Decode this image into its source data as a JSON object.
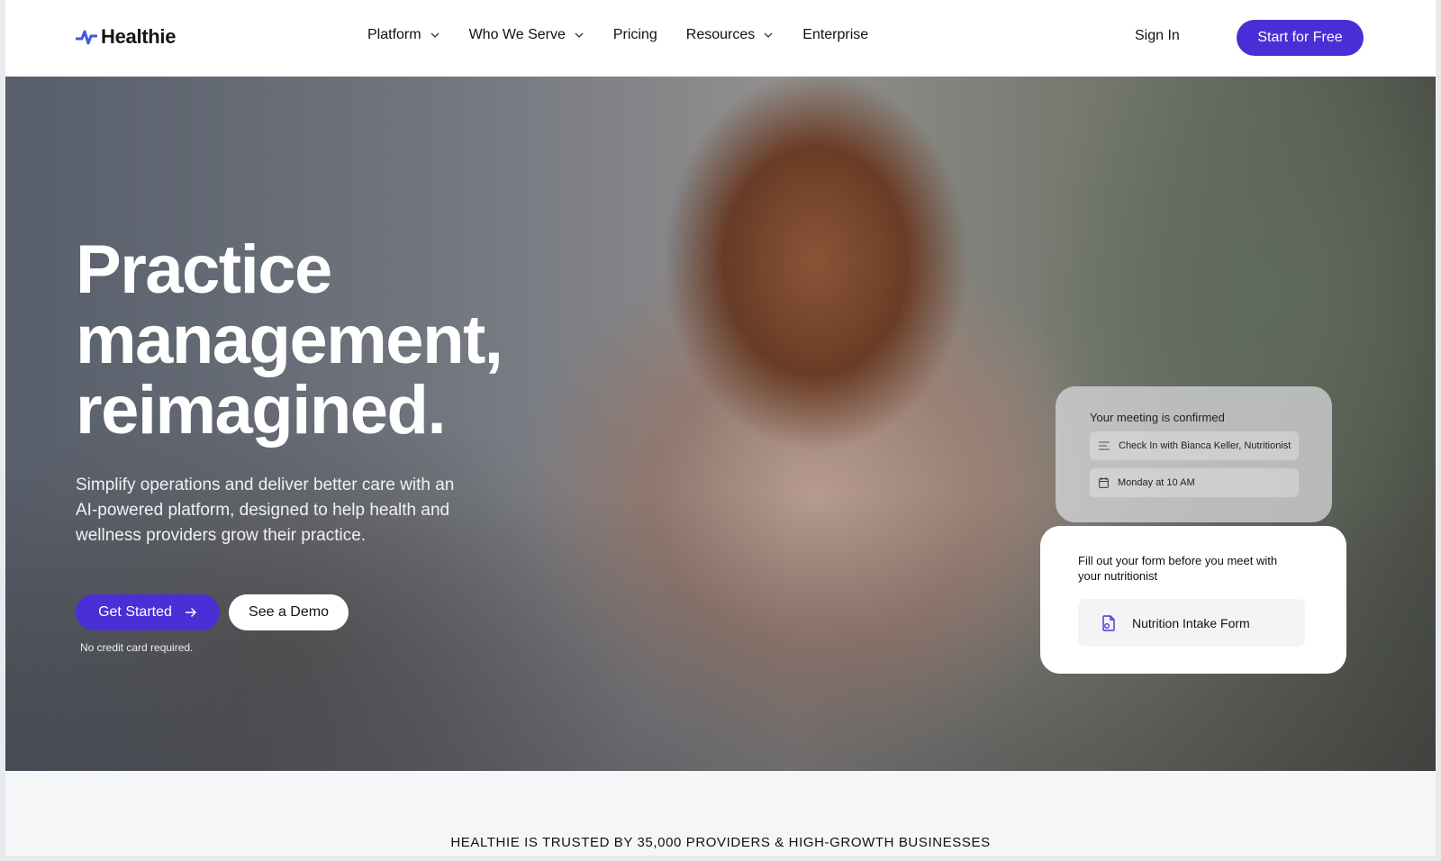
{
  "header": {
    "logo_text": "Healthie",
    "nav": [
      {
        "label": "Platform",
        "has_dropdown": true
      },
      {
        "label": "Who We Serve",
        "has_dropdown": true
      },
      {
        "label": "Pricing",
        "has_dropdown": false
      },
      {
        "label": "Resources",
        "has_dropdown": true
      },
      {
        "label": "Enterprise",
        "has_dropdown": false
      }
    ],
    "sign_in": "Sign In",
    "cta": "Start for Free"
  },
  "hero": {
    "title_lines": [
      "Practice",
      "management,",
      "reimagined."
    ],
    "subtitle": "Simplify operations and deliver better care with an AI-powered platform, designed to help health and wellness providers grow their practice.",
    "primary_button": "Get Started",
    "secondary_button": "See a Demo",
    "note": "No credit card required."
  },
  "meeting_card": {
    "title": "Your meeting is confirmed",
    "event": "Check In with Bianca Keller, Nutritionist",
    "time": "Monday at 10 AM"
  },
  "form_card": {
    "title": "Fill out your form before you meet with your nutritionist",
    "form_name": "Nutrition Intake Form"
  },
  "trusted": {
    "text": "HEALTHIE IS TRUSTED BY 35,000 PROVIDERS & HIGH-GROWTH BUSINESSES"
  },
  "colors": {
    "brand": "#4a2fd6",
    "logo_accent": "#3b5bdb"
  },
  "icons": [
    "logo-pulse-icon",
    "chevron-down-icon",
    "arrow-right-icon",
    "list-icon",
    "calendar-icon",
    "document-icon"
  ]
}
